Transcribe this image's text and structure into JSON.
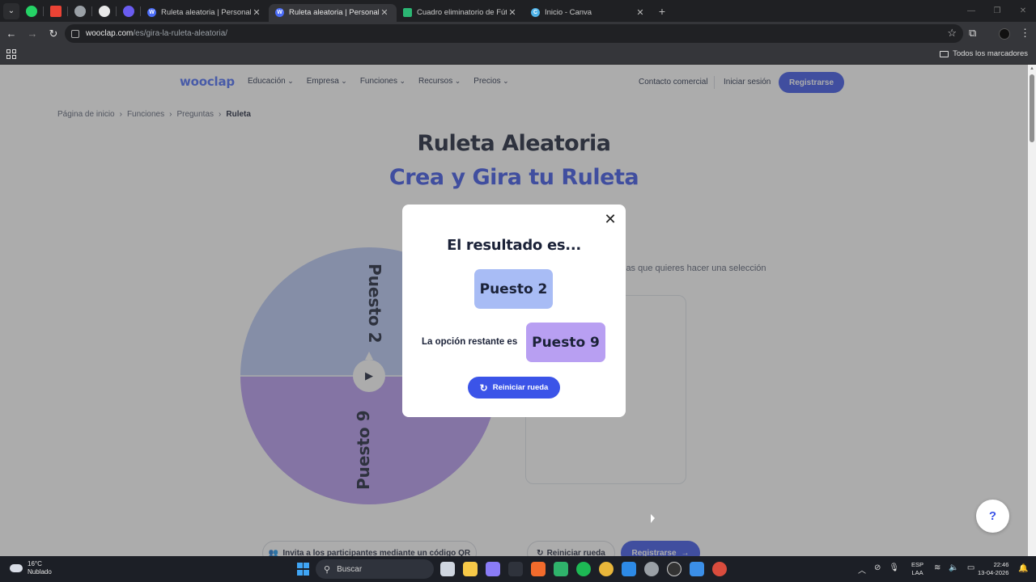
{
  "browser": {
    "tabs": [
      {
        "title": "Ruleta aleatoria | Personaliza y g",
        "favicon_color": "#4a6cf7",
        "favicon_letter": "W",
        "active": false
      },
      {
        "title": "Ruleta aleatoria | Personaliza y g",
        "favicon_color": "#4a6cf7",
        "favicon_letter": "W",
        "active": true
      },
      {
        "title": "Cuadro eliminatorio de Fútbol",
        "favicon_color": "#2bb673",
        "favicon_letter": "",
        "active": false
      },
      {
        "title": "Inicio - Canva",
        "favicon_color": "#4fb3e8",
        "favicon_letter": "C",
        "active": false
      }
    ],
    "url_host": "wooclap.com",
    "url_path": "/es/gira-la-ruleta-aleatoria/",
    "bookmarks_label": "Todos los marcadores"
  },
  "site": {
    "logo": "wooclap",
    "menu": [
      "Educación",
      "Empresa",
      "Funciones",
      "Recursos",
      "Precios"
    ],
    "contact": "Contacto comercial",
    "login": "Iniciar sesión",
    "signup": "Registrarse"
  },
  "breadcrumbs": [
    "Página de inicio",
    "Funciones",
    "Preguntas",
    "Ruleta"
  ],
  "hero": {
    "title": "Ruleta Aleatoria",
    "subtitle": "Crea y Gira tu Ruleta"
  },
  "wheel": {
    "segments": [
      {
        "label": "Puesto 2",
        "color": "#b8c8f6"
      },
      {
        "label": "Puesto 9",
        "color": "#b69af0"
      }
    ]
  },
  "entries_hint": "las que quieres hacer una selección",
  "bottom_buttons": {
    "invite": "Invita a los participantes mediante un código QR",
    "reset": "Reiniciar rueda",
    "signup": "Registrarse"
  },
  "modal": {
    "title": "El resultado es...",
    "result": "Puesto 2",
    "remaining_label": "La opción restante es",
    "remaining": "Puesto 9",
    "reset_button": "Reiniciar rueda"
  },
  "help_label": "?",
  "taskbar": {
    "temperature": "16°C",
    "weather": "Nublado",
    "search": "Buscar",
    "lang_1": "ESP",
    "lang_2": "LAA",
    "time": "22:46",
    "date": "13-04-2026"
  },
  "colors": {
    "brand": "#3b54e8",
    "segment_top": "#b8c8f6",
    "segment_bottom": "#b69af0"
  }
}
